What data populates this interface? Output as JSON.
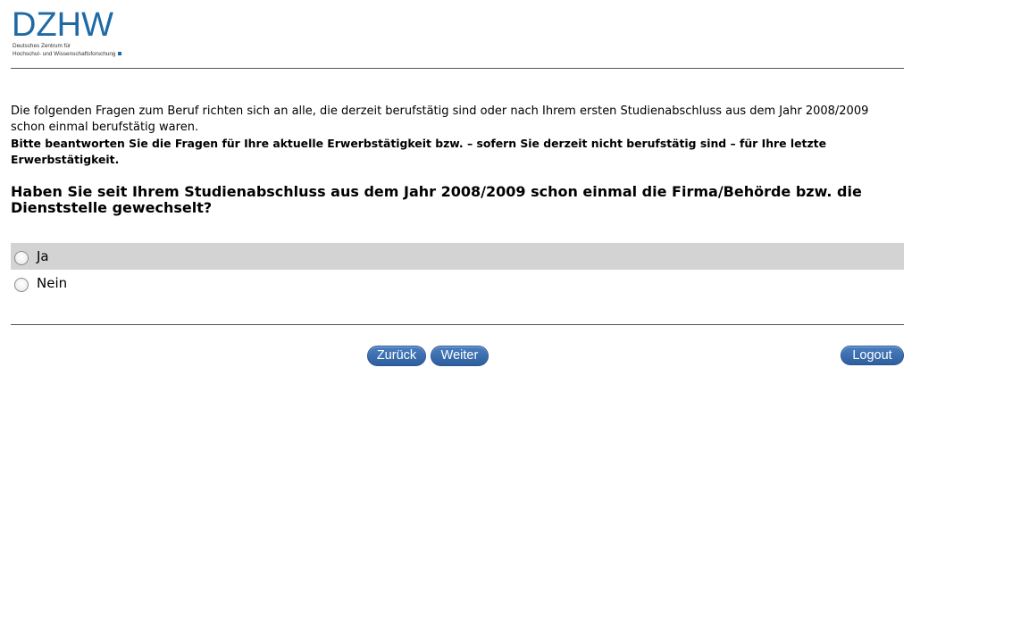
{
  "logo": {
    "mark": "DZHW",
    "line1": "Deutsches Zentrum für",
    "line2": "Hochschul- und Wissenschaftsforschung"
  },
  "intro": {
    "text": "Die folgenden Fragen zum Beruf richten sich an alle, die derzeit berufstätig sind oder nach Ihrem ersten Studienabschluss aus dem Jahr 2008/2009 schon einmal berufstätig waren.",
    "bold_text": "Bitte beantworten Sie die Fragen für Ihre aktuelle Erwerbstätigkeit bzw. – sofern Sie derzeit nicht berufstätig sind – für Ihre letzte Erwerbstätigkeit."
  },
  "question": {
    "text": "Haben Sie seit Ihrem Studienabschluss aus dem Jahr 2008/2009 schon einmal die Firma/Behörde bzw. die Dienststelle gewechselt?"
  },
  "options": [
    {
      "label": "Ja",
      "selected": false,
      "highlighted": true
    },
    {
      "label": "Nein",
      "selected": false,
      "highlighted": false
    }
  ],
  "nav": {
    "back_label": "Zurück",
    "next_label": "Weiter",
    "logout_label": "Logout"
  },
  "colors": {
    "brand": "#1f6aa5",
    "button": "#3a6eb0",
    "highlight_row": "#d3d3d3"
  }
}
